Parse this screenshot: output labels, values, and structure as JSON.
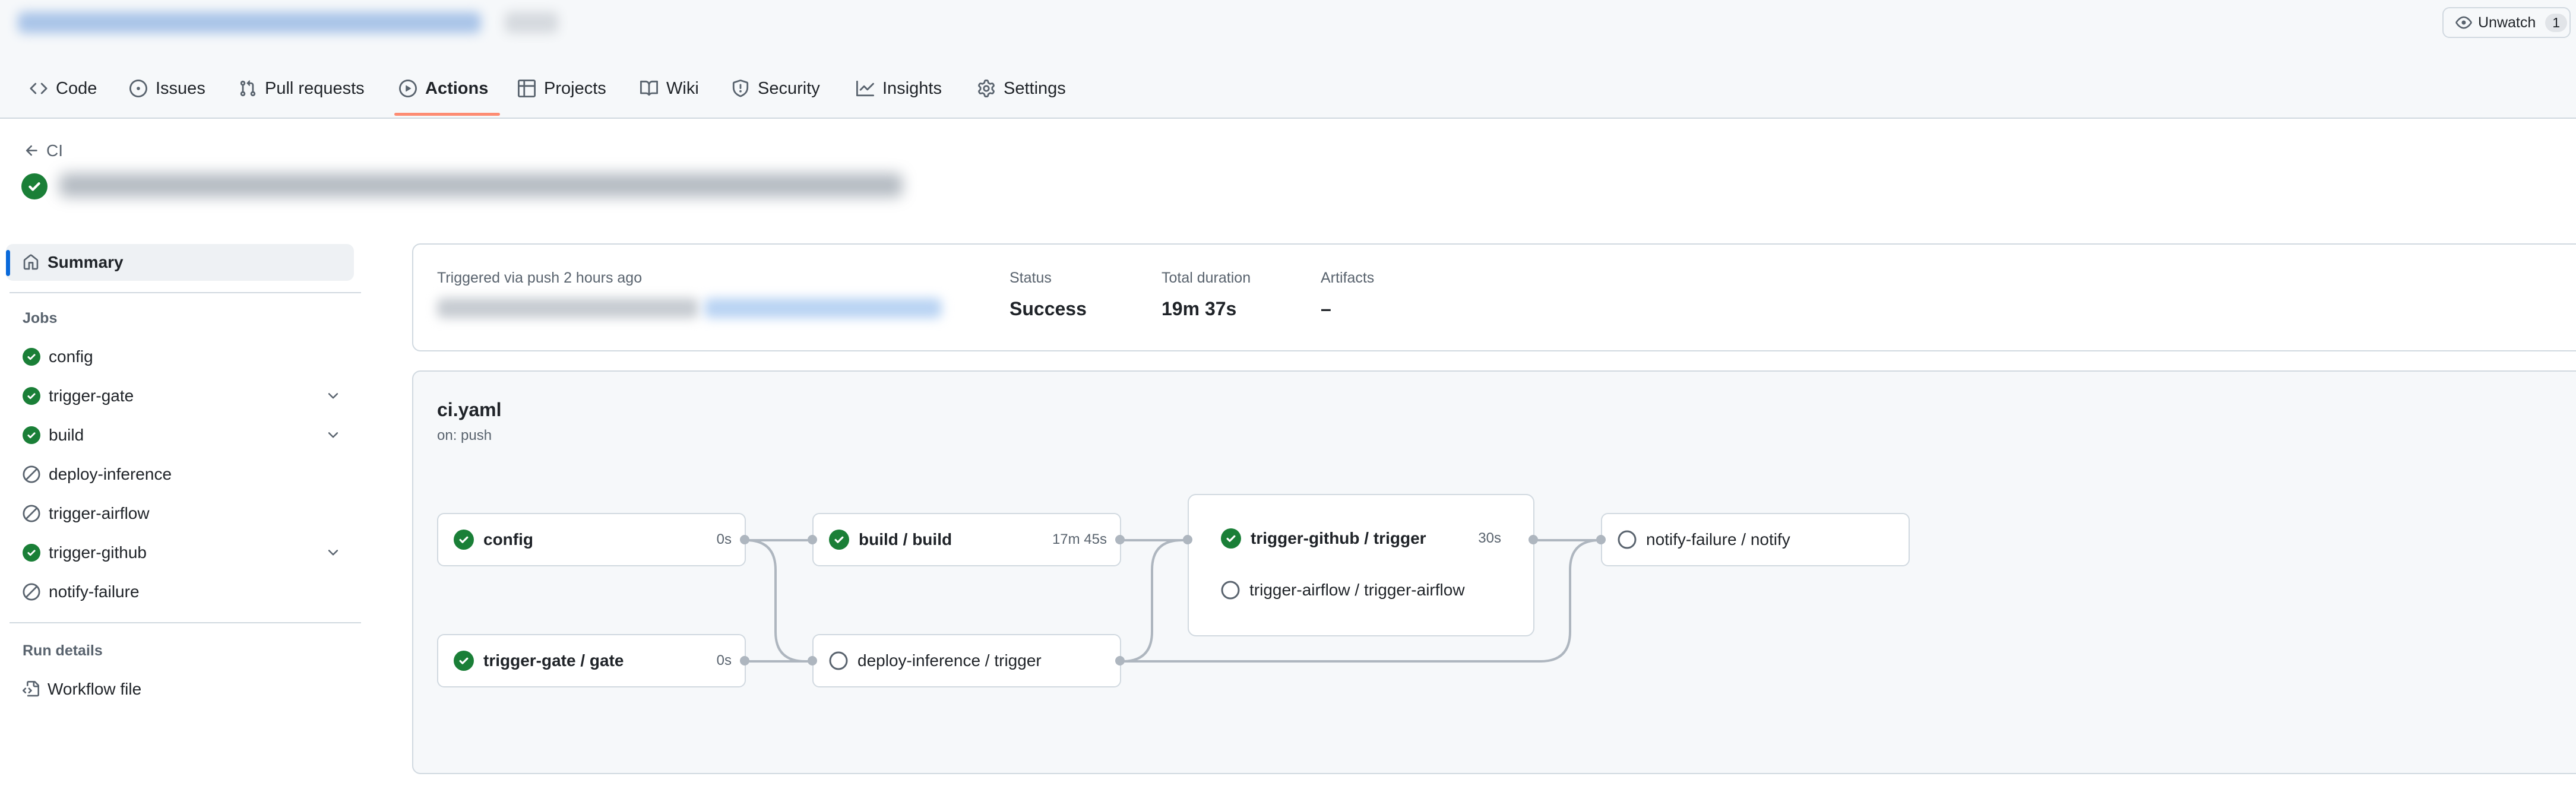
{
  "repo": {
    "watch_label": "Unwatch",
    "watch_count": "1"
  },
  "nav": {
    "tabs": [
      {
        "label": "Code",
        "icon": "code-icon"
      },
      {
        "label": "Issues",
        "icon": "issue-opened-icon"
      },
      {
        "label": "Pull requests",
        "icon": "git-pull-request-icon"
      },
      {
        "label": "Actions",
        "icon": "play-icon",
        "active": true
      },
      {
        "label": "Projects",
        "icon": "table-icon"
      },
      {
        "label": "Wiki",
        "icon": "book-icon"
      },
      {
        "label": "Security",
        "icon": "shield-icon"
      },
      {
        "label": "Insights",
        "icon": "graph-icon"
      },
      {
        "label": "Settings",
        "icon": "gear-icon"
      }
    ]
  },
  "header": {
    "back_label": "CI",
    "run_status": "success"
  },
  "sidebar": {
    "summary_label": "Summary",
    "jobs_heading": "Jobs",
    "jobs": [
      {
        "label": "config",
        "status": "success",
        "expandable": false
      },
      {
        "label": "trigger-gate",
        "status": "success",
        "expandable": true
      },
      {
        "label": "build",
        "status": "success",
        "expandable": true
      },
      {
        "label": "deploy-inference",
        "status": "skipped",
        "expandable": false
      },
      {
        "label": "trigger-airflow",
        "status": "skipped",
        "expandable": false
      },
      {
        "label": "trigger-github",
        "status": "success",
        "expandable": true
      },
      {
        "label": "notify-failure",
        "status": "skipped",
        "expandable": false
      }
    ],
    "run_details_heading": "Run details",
    "workflow_file_label": "Workflow file"
  },
  "summary": {
    "triggered_text": "Triggered via push 2 hours ago",
    "status_label": "Status",
    "status_value": "Success",
    "duration_label": "Total duration",
    "duration_value": "19m 37s",
    "artifacts_label": "Artifacts",
    "artifacts_value": "–"
  },
  "workflow": {
    "file_name": "ci.yaml",
    "trigger": "on: push",
    "nodes": {
      "config": {
        "label": "config",
        "duration": "0s",
        "status": "success"
      },
      "gate": {
        "label": "trigger-gate / gate",
        "duration": "0s",
        "status": "success"
      },
      "build": {
        "label": "build / build",
        "duration": "17m 45s",
        "status": "success"
      },
      "deploy": {
        "label": "deploy-inference / trigger",
        "status": "skipped"
      },
      "github": {
        "label": "trigger-github / trigger",
        "duration": "30s",
        "status": "success"
      },
      "airflow": {
        "label": "trigger-airflow / trigger-airflow",
        "status": "skipped"
      },
      "notify": {
        "label": "notify-failure / notify",
        "status": "skipped"
      }
    }
  },
  "colors": {
    "success": "#1a7f37",
    "skipped": "#59636e",
    "active_tab_underline": "#fd8c73",
    "accent": "#0969da"
  }
}
